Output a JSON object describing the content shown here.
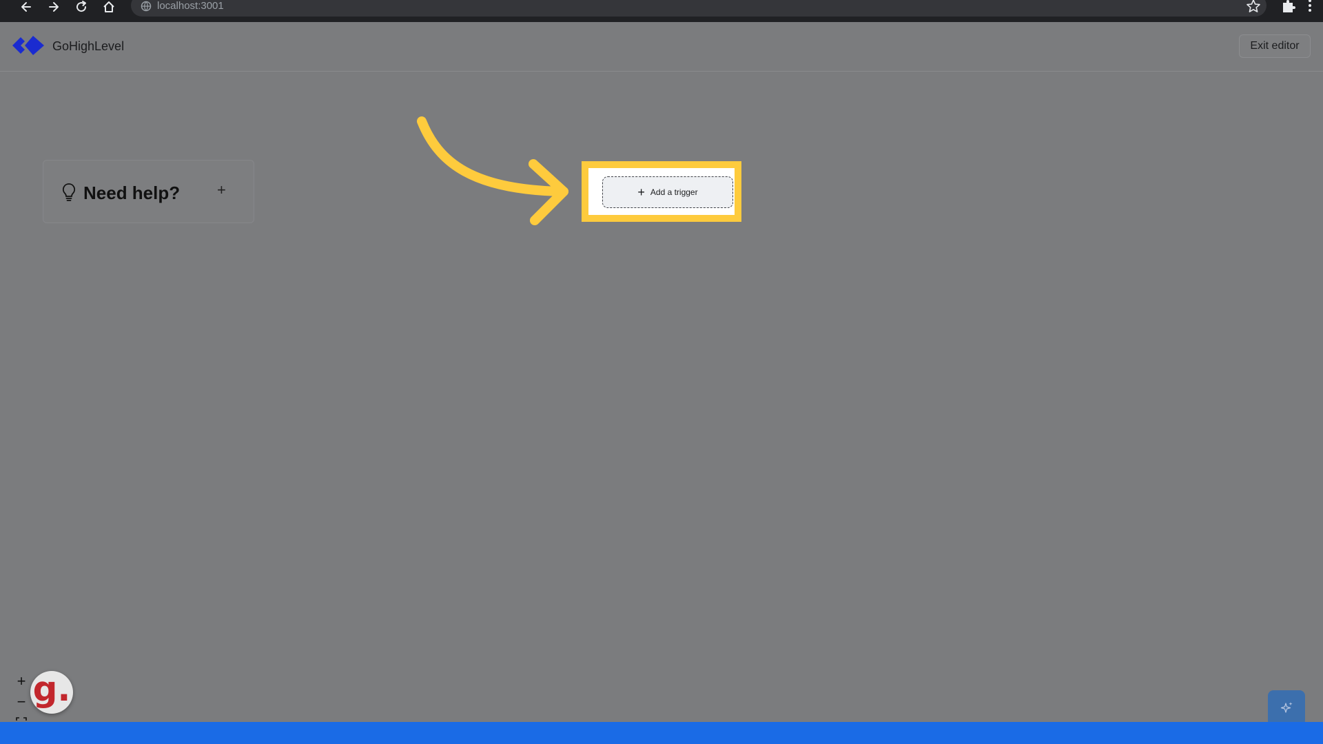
{
  "browser": {
    "url": "localhost:3001"
  },
  "app": {
    "brand_name": "GoHighLevel",
    "exit_label": "Exit editor"
  },
  "help_card": {
    "title": "Need help?",
    "expand_symbol": "+"
  },
  "canvas": {
    "add_trigger_label": "Add a trigger",
    "add_trigger_symbol": "+"
  },
  "zoom": {
    "zoom_in_symbol": "+",
    "zoom_out_symbol": "−"
  },
  "badge": {
    "letter": "g."
  },
  "colors": {
    "highlight": "#fecb3d",
    "logo_blue": "#1a2bd0",
    "bottom_bar": "#1a6be6"
  },
  "icons": [
    "back-arrow-icon",
    "forward-arrow-icon",
    "reload-icon",
    "home-icon",
    "globe-icon",
    "star-icon",
    "puzzle-icon",
    "kebab-menu-icon",
    "lightbulb-icon",
    "fit-view-icon",
    "sparkle-icon"
  ]
}
